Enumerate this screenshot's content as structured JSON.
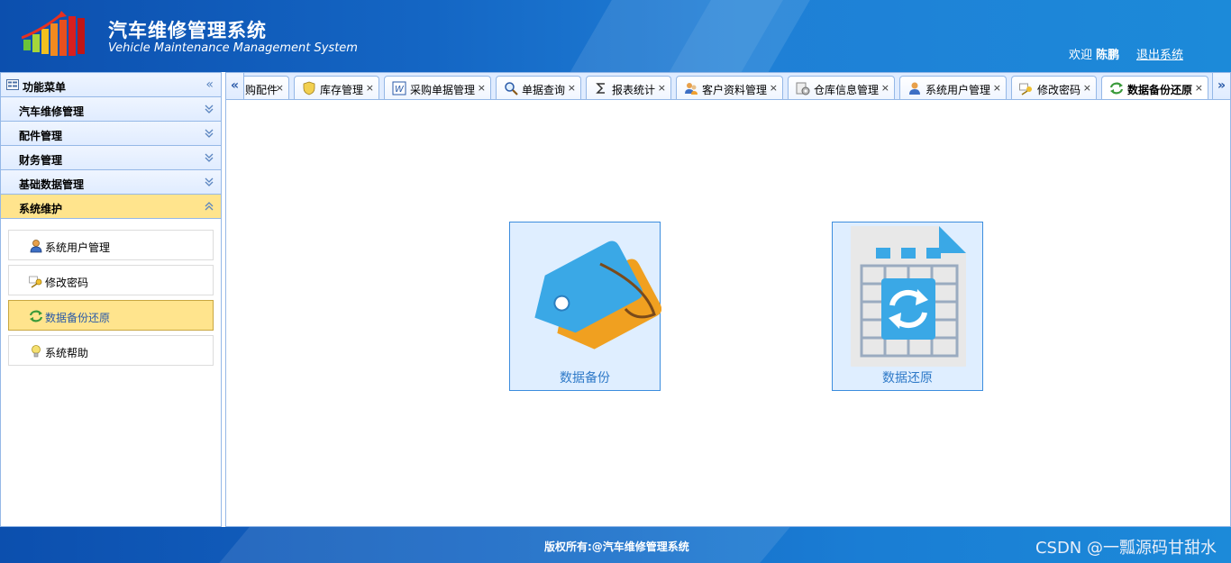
{
  "header": {
    "title_cn": "汽车维修管理系统",
    "title_en": "Vehicle Maintenance Management System",
    "welcome_prefix": "欢迎",
    "user_name": "陈鹏",
    "logout": "退出系统"
  },
  "sidebar": {
    "title": "功能菜单",
    "sections": [
      {
        "label": "汽车维修管理",
        "expanded": false
      },
      {
        "label": "配件管理",
        "expanded": false
      },
      {
        "label": "财务管理",
        "expanded": false
      },
      {
        "label": "基础数据管理",
        "expanded": false
      },
      {
        "label": "系统维护",
        "expanded": true
      }
    ],
    "items": [
      {
        "label": "系统用户管理",
        "icon": "user-icon"
      },
      {
        "label": "修改密码",
        "icon": "key-icon"
      },
      {
        "label": "数据备份还原",
        "icon": "refresh-icon",
        "active": true
      },
      {
        "label": "系统帮助",
        "icon": "bulb-icon"
      }
    ]
  },
  "tabs": [
    {
      "label": "购配件",
      "icon": ""
    },
    {
      "label": "库存管理",
      "icon": "shield-icon"
    },
    {
      "label": "采购单据管理",
      "icon": "word-icon"
    },
    {
      "label": "单据查询",
      "icon": "search-icon"
    },
    {
      "label": "报表统计",
      "icon": "sigma-icon"
    },
    {
      "label": "客户资料管理",
      "icon": "people-icon"
    },
    {
      "label": "仓库信息管理",
      "icon": "gear-icon"
    },
    {
      "label": "系统用户管理",
      "icon": "user-icon"
    },
    {
      "label": "修改密码",
      "icon": "key-icon"
    },
    {
      "label": "数据备份还原",
      "icon": "refresh-icon",
      "selected": true
    }
  ],
  "tab_close": "×",
  "tiles": {
    "backup": "数据备份",
    "restore": "数据还原"
  },
  "footer": {
    "copyright": "版权所有:@汽车维修管理系统",
    "watermark": "CSDN @一瓢源码甘甜水"
  },
  "colors": {
    "header_blue": "#1466c4",
    "active_yellow": "#ffe48d",
    "border_blue": "#95b8e7"
  }
}
